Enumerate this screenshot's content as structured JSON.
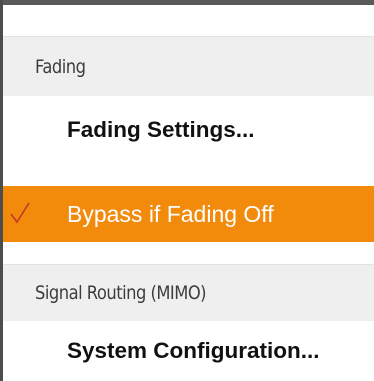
{
  "menu": {
    "sections": [
      {
        "header": "Fading",
        "items": [
          {
            "label": "Fading Settings...",
            "checked": false,
            "highlighted": false
          },
          {
            "label": "Bypass if Fading Off",
            "checked": true,
            "highlighted": true
          }
        ]
      },
      {
        "header": "Signal Routing (MIMO)",
        "items": [
          {
            "label": "System Configuration...",
            "checked": false,
            "highlighted": false
          }
        ]
      }
    ]
  },
  "colors": {
    "highlight": "#f28a0c",
    "header_bg": "#efefef",
    "frame": "#5a5a5a",
    "checkmark": "#c0392b"
  },
  "icons": {
    "check": "checkmark-icon"
  }
}
